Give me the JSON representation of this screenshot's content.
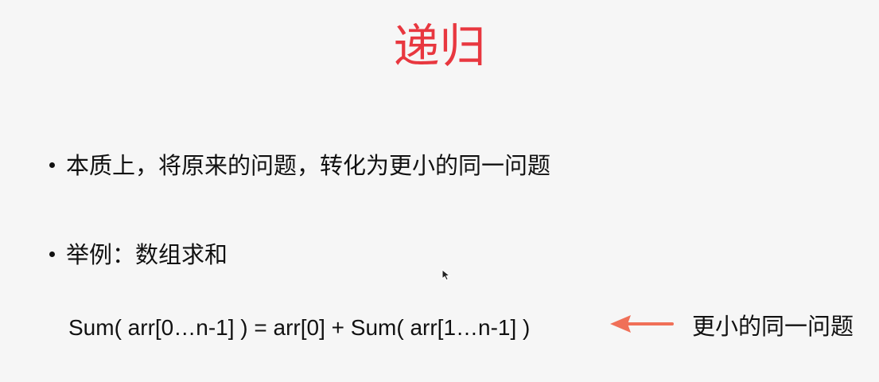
{
  "title": "递归",
  "bullets": [
    "本质上，将原来的问题，转化为更小的同一问题",
    "举例：数组求和"
  ],
  "formula": "Sum( arr[0…n-1] ) = arr[0] + Sum( arr[1…n-1] )",
  "annotation": "更小的同一问题",
  "colors": {
    "title": "#e8373f",
    "arrow": "#f07058"
  },
  "icons": {
    "arrow": "left-arrow-icon",
    "cursor": "mouse-cursor-icon"
  }
}
